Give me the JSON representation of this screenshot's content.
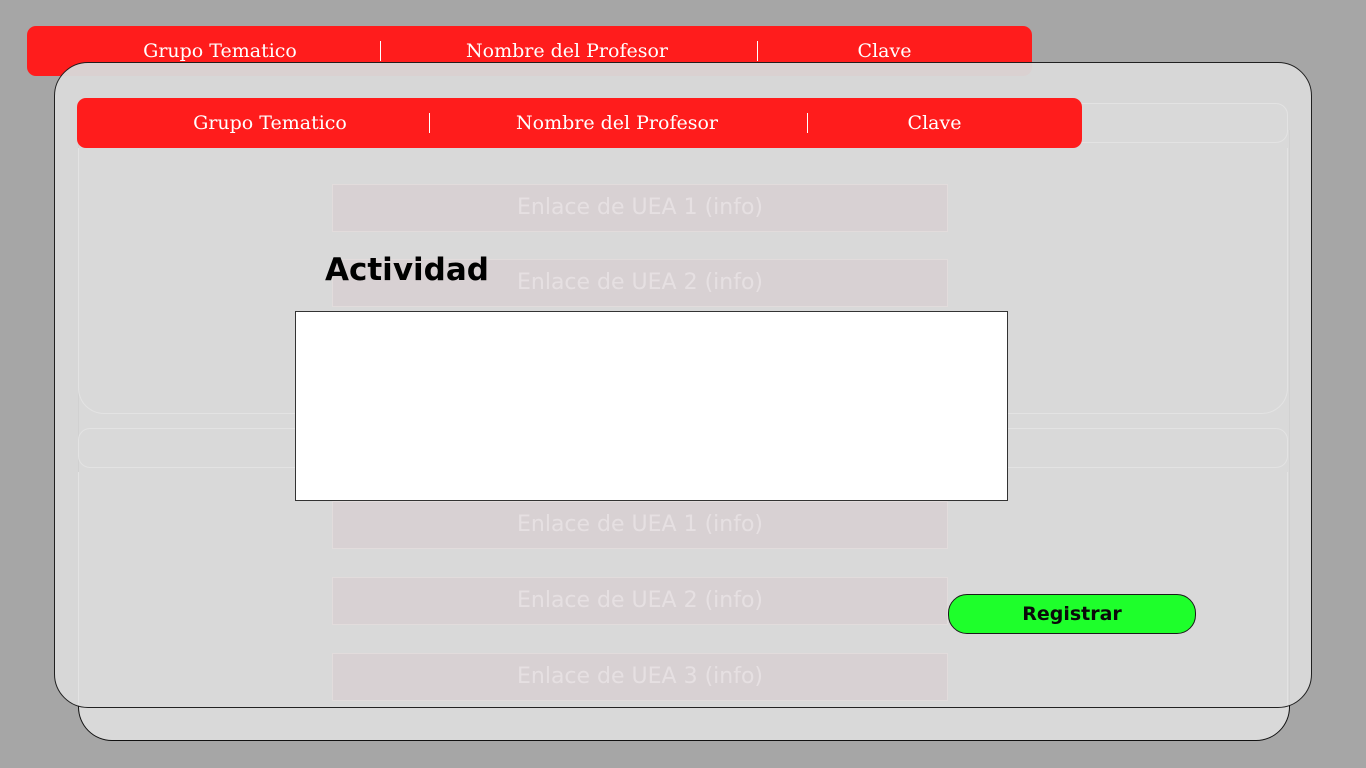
{
  "header": {
    "group_label": "Grupo Tematico",
    "professor_label": "Nombre del Profesor",
    "key_label": "Clave"
  },
  "background_links": {
    "section1": [
      "Enlace de UEA 1 (info)",
      "Enlace de UEA 2 (info)"
    ],
    "section2": [
      "Enlace de UEA 1 (info)",
      "Enlace de UEA 2 (info)",
      "Enlace de UEA 3 (info)"
    ]
  },
  "modal": {
    "title": "Actividad",
    "activity_value": "",
    "register_label": "Registrar"
  },
  "colors": {
    "header": "#ff1c1c",
    "register": "#1eff2b",
    "background": "#a6a6a6",
    "card": "#d9d9d9"
  }
}
